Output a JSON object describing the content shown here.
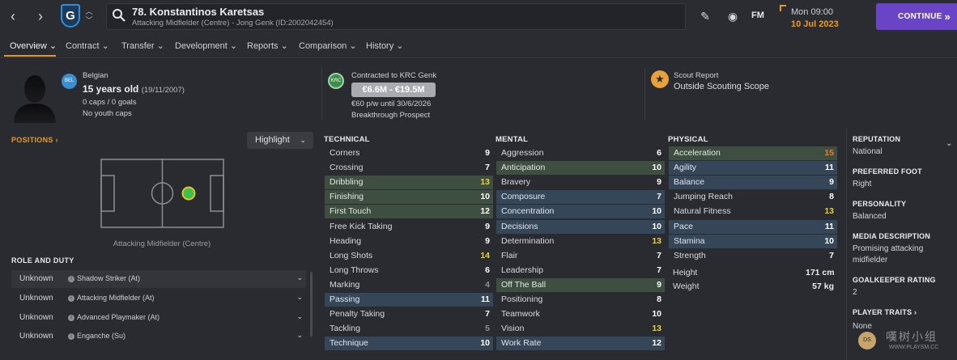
{
  "topbar": {
    "player_name": "78. Konstantinos Karetsas",
    "player_subtitle": "Attacking Midfielder (Centre) - Jong Genk (ID:2002042454)",
    "badge_letter": "G",
    "fm_label": "FM",
    "date_day": "Mon 09:00",
    "date_full": "10 Jul 2023",
    "continue_label": "CONTINUE",
    "colors": {
      "accent": "#e39a2c",
      "continue": "#6a44c7",
      "date": "#f29a1f"
    }
  },
  "tabs": [
    {
      "label": "Overview ⌄"
    },
    {
      "label": "Contract ⌄"
    },
    {
      "label": "Transfer ⌄"
    },
    {
      "label": "Development ⌄"
    },
    {
      "label": "Reports ⌄"
    },
    {
      "label": "Comparison ⌄"
    },
    {
      "label": "History ⌄"
    }
  ],
  "header": {
    "nationality": "Belgian",
    "age_text": "15 years old",
    "dob": "(19/11/2007)",
    "caps": "0 caps / 0 goals",
    "youth_caps": "No youth caps",
    "nation_flag_text": "BEL",
    "contract_title": "Contracted to KRC Genk",
    "club_icon_text": "KRC",
    "value_range": "€6.6M - €19.5M",
    "wage": "€60 p/w until 30/6/2026",
    "prospect": "Breakthrough Prospect",
    "scout_title": "Scout Report",
    "scout_value": "Outside Scouting Scope"
  },
  "left": {
    "positions_label": "POSITIONS ›",
    "highlight_label": "Highlight",
    "pitch_caption": "Attacking Midfielder (Centre)",
    "role_title": "ROLE AND DUTY",
    "roles": [
      {
        "duty": "Unknown",
        "name": "Shadow Striker (At)"
      },
      {
        "duty": "Unknown",
        "name": "Attacking Midfielder (At)"
      },
      {
        "duty": "Unknown",
        "name": "Advanced Playmaker (At)"
      },
      {
        "duty": "Unknown",
        "name": "Enganche (Su)"
      }
    ]
  },
  "attributes": {
    "technical_title": "TECHNICAL",
    "mental_title": "MENTAL",
    "physical_title": "PHYSICAL",
    "technical": [
      {
        "name": "Corners",
        "value": "9",
        "hl": ""
      },
      {
        "name": "Crossing",
        "value": "7",
        "hl": ""
      },
      {
        "name": "Dribbling",
        "value": "13",
        "hl": "green"
      },
      {
        "name": "Finishing",
        "value": "10",
        "hl": "green"
      },
      {
        "name": "First Touch",
        "value": "12",
        "hl": "green"
      },
      {
        "name": "Free Kick Taking",
        "value": "9",
        "hl": ""
      },
      {
        "name": "Heading",
        "value": "9",
        "hl": ""
      },
      {
        "name": "Long Shots",
        "value": "14",
        "hl": ""
      },
      {
        "name": "Long Throws",
        "value": "6",
        "hl": ""
      },
      {
        "name": "Marking",
        "value": "4",
        "hl": ""
      },
      {
        "name": "Passing",
        "value": "11",
        "hl": "blue"
      },
      {
        "name": "Penalty Taking",
        "value": "7",
        "hl": ""
      },
      {
        "name": "Tackling",
        "value": "5",
        "hl": ""
      },
      {
        "name": "Technique",
        "value": "10",
        "hl": "blue"
      }
    ],
    "mental": [
      {
        "name": "Aggression",
        "value": "6",
        "hl": ""
      },
      {
        "name": "Anticipation",
        "value": "10",
        "hl": "green"
      },
      {
        "name": "Bravery",
        "value": "9",
        "hl": ""
      },
      {
        "name": "Composure",
        "value": "7",
        "hl": "blue"
      },
      {
        "name": "Concentration",
        "value": "10",
        "hl": "blue"
      },
      {
        "name": "Decisions",
        "value": "10",
        "hl": "blue"
      },
      {
        "name": "Determination",
        "value": "13",
        "hl": ""
      },
      {
        "name": "Flair",
        "value": "7",
        "hl": ""
      },
      {
        "name": "Leadership",
        "value": "7",
        "hl": ""
      },
      {
        "name": "Off The Ball",
        "value": "9",
        "hl": "green"
      },
      {
        "name": "Positioning",
        "value": "8",
        "hl": ""
      },
      {
        "name": "Teamwork",
        "value": "10",
        "hl": ""
      },
      {
        "name": "Vision",
        "value": "13",
        "hl": ""
      },
      {
        "name": "Work Rate",
        "value": "12",
        "hl": "blue"
      }
    ],
    "physical": [
      {
        "name": "Acceleration",
        "value": "15",
        "hl": "green"
      },
      {
        "name": "Agility",
        "value": "11",
        "hl": "blue"
      },
      {
        "name": "Balance",
        "value": "9",
        "hl": "blue"
      },
      {
        "name": "Jumping Reach",
        "value": "8",
        "hl": ""
      },
      {
        "name": "Natural Fitness",
        "value": "13",
        "hl": ""
      },
      {
        "name": "Pace",
        "value": "11",
        "hl": "blue"
      },
      {
        "name": "Stamina",
        "value": "10",
        "hl": "blue"
      },
      {
        "name": "Strength",
        "value": "7",
        "hl": ""
      }
    ],
    "height_label": "Height",
    "height_value": "171 cm",
    "weight_label": "Weight",
    "weight_value": "57 kg",
    "value_colors": {
      "low": "#8f8f96",
      "mid": "#ffffff",
      "good": "#e8d23a",
      "high": "#f07a2a"
    }
  },
  "right": {
    "reputation_title": "REPUTATION",
    "reputation_value": "National",
    "foot_title": "PREFERRED FOOT",
    "foot_value": "Right",
    "personality_title": "PERSONALITY",
    "personality_value": "Balanced",
    "media_title": "MEDIA DESCRIPTION",
    "media_value_1": "Promising attacking",
    "media_value_2": "midfielder",
    "gk_title": "GOALKEEPER RATING",
    "gk_value": "2",
    "traits_title": "PLAYER TRAITS ›",
    "traits_value": "None"
  },
  "watermark": {
    "text": "嘆树小组",
    "url": "WWW.PLAYSM.CC"
  }
}
